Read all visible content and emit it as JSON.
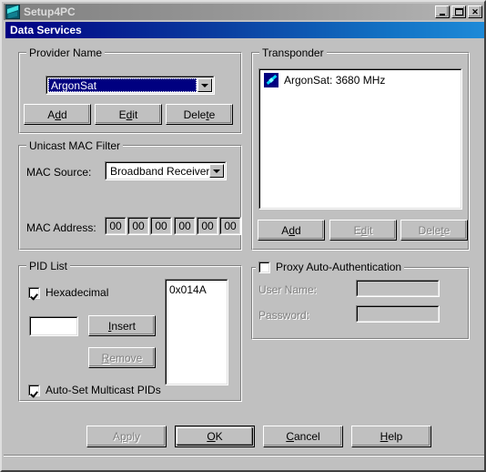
{
  "window": {
    "app_title": "Setup4PC",
    "app_icon": "satellite-dish-icon",
    "minimize_label": "_",
    "maximize_label": "□",
    "close_label": "✕"
  },
  "dialog": {
    "title": "Data Services"
  },
  "provider_name": {
    "group_label": "Provider Name",
    "combo_value": "ArgonSat",
    "buttons": [
      {
        "name": "add",
        "label_before": "A",
        "label_accel": "d",
        "label_after": "d",
        "enabled": true
      },
      {
        "name": "edit",
        "label_before": "E",
        "label_accel": "d",
        "label_after": "it",
        "enabled": true
      },
      {
        "name": "delete",
        "label_before": "Dele",
        "label_accel": "t",
        "label_after": "e",
        "enabled": true
      }
    ]
  },
  "unicast_mac_filter": {
    "group_label": "Unicast MAC Filter",
    "mac_source_label": "MAC Source:",
    "mac_source_value": "Broadband Receiver",
    "mac_address_label": "MAC Address:",
    "mac_octets": [
      "00",
      "00",
      "00",
      "00",
      "00",
      "00"
    ]
  },
  "pid_list": {
    "group_label": "PID List",
    "hexadecimal_label": "Hexadecimal",
    "hexadecimal_checked": true,
    "pid_input_value": "",
    "insert_before": "",
    "insert_accel": "I",
    "insert_after": "nsert",
    "remove_before": "",
    "remove_accel": "R",
    "remove_after": "emove",
    "remove_enabled": false,
    "list_items": [
      "0x014A"
    ],
    "autoset_label": "Auto-Set Multicast PIDs",
    "autoset_checked": true
  },
  "transponder": {
    "group_label": "Transponder",
    "items": [
      {
        "icon": "satellite-link-icon",
        "label": "ArgonSat: 3680 MHz"
      }
    ],
    "buttons": [
      {
        "name": "add",
        "label_before": "A",
        "label_accel": "d",
        "label_after": "d",
        "enabled": true
      },
      {
        "name": "edit",
        "label_before": "E",
        "label_accel": "d",
        "label_after": "it",
        "enabled": false
      },
      {
        "name": "delete",
        "label_before": "Dele",
        "label_accel": "t",
        "label_after": "e",
        "enabled": false
      }
    ]
  },
  "proxy_auth": {
    "group_label": "Proxy Auto-Authentication",
    "checked": false,
    "user_name_label": "User Name:",
    "user_name_value": "",
    "password_label": "Password:",
    "password_value": ""
  },
  "footer": {
    "apply_before": "A",
    "apply_accel": "p",
    "apply_after": "ply",
    "apply_enabled": false,
    "ok_before": "",
    "ok_accel": "O",
    "ok_after": "K",
    "ok_default": true,
    "cancel_before": "",
    "cancel_accel": "C",
    "cancel_after": "ancel",
    "help_before": "",
    "help_accel": "H",
    "help_after": "elp"
  },
  "colors": {
    "face": "#c0c0c0",
    "active_title_start": "#000082",
    "active_title_end": "#1e8ad8",
    "inactive_title_start": "#808080",
    "inactive_title_end": "#b4b4b4",
    "selection": "#000080",
    "disabled_text": "#808080"
  }
}
